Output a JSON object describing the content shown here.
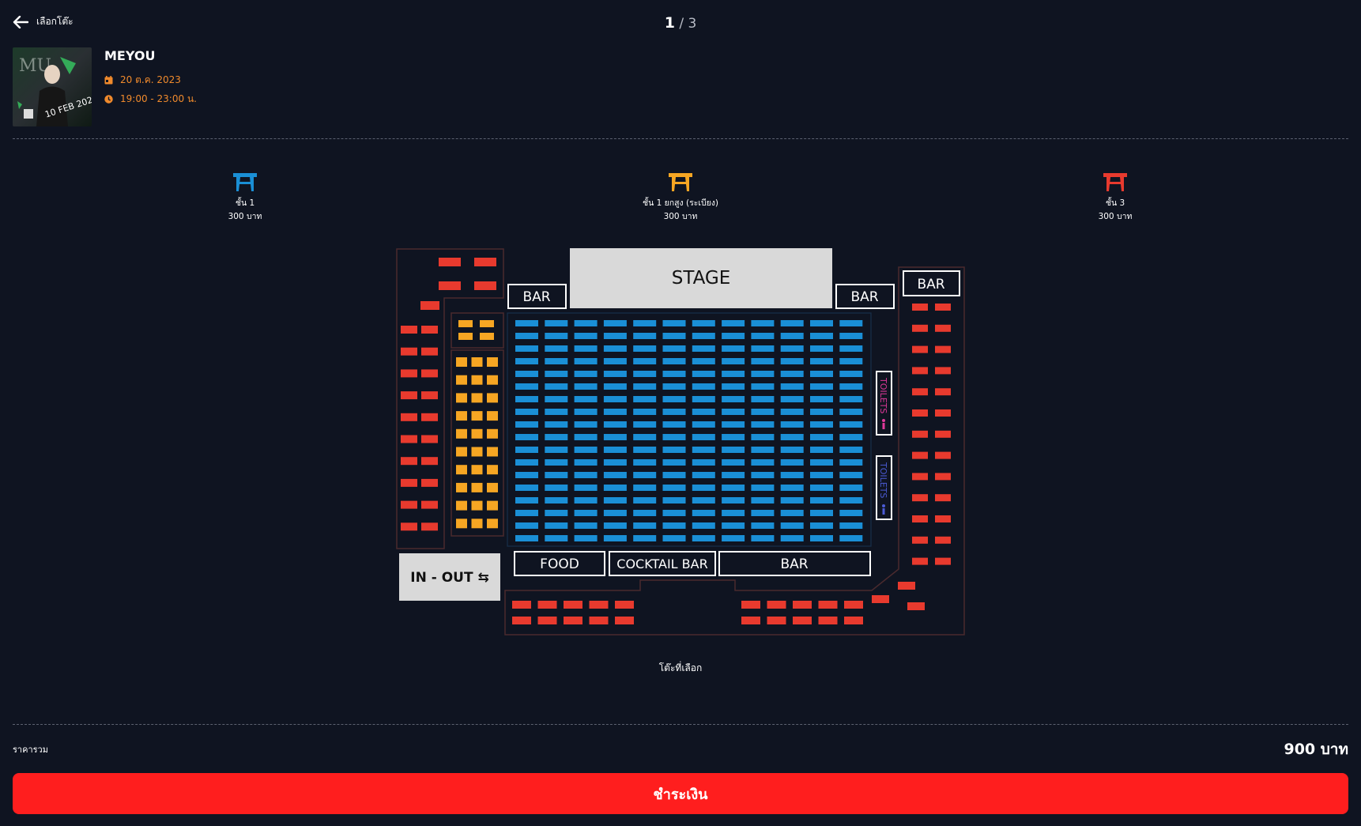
{
  "header": {
    "back_label": "เลือกโต๊ะ",
    "page_current": "1",
    "page_sep": "/",
    "page_total": "3"
  },
  "event": {
    "title": "MEYOU",
    "date": "20 ต.ค. 2023",
    "time": "19:00 - 23:00 น."
  },
  "legend": [
    {
      "label": "ชั้น 1",
      "price": "300 บาท",
      "color": "#1a8fd6"
    },
    {
      "label": "ชั้น 1 ยกสูง (ระเบียง)",
      "price": "300 บาท",
      "color": "#f6a623"
    },
    {
      "label": "ชั้น 3",
      "price": "300 บาท",
      "color": "#e83a2e"
    }
  ],
  "map": {
    "stage": "STAGE",
    "bar_left": "BAR",
    "bar_right": "BAR",
    "bar_far_right": "BAR",
    "food": "FOOD",
    "cocktail_bar": "COCKTAIL BAR",
    "bar_bottom": "BAR",
    "in_out": "IN - OUT ⇆",
    "toilets_women": "TOILETS",
    "toilets_men": "TOILETS",
    "colors": {
      "zone1": "#1a8fd6",
      "zone1_raised": "#f6a623",
      "zone3": "#e83a2e",
      "outline": "#4a2a2e",
      "women": "#e0399a",
      "men": "#4b5bd6"
    },
    "zone1_grid": {
      "rows": 18,
      "cols": 12
    },
    "balcony_grid": {
      "top_rows": 2,
      "top_cols": 2,
      "rows": 10,
      "cols": 3
    }
  },
  "selection": {
    "label": "โต๊ะที่เลือก"
  },
  "footer": {
    "total_label": "ราคารวม",
    "total_value": "900 บาท",
    "pay_label": "ชำระเงิน"
  }
}
